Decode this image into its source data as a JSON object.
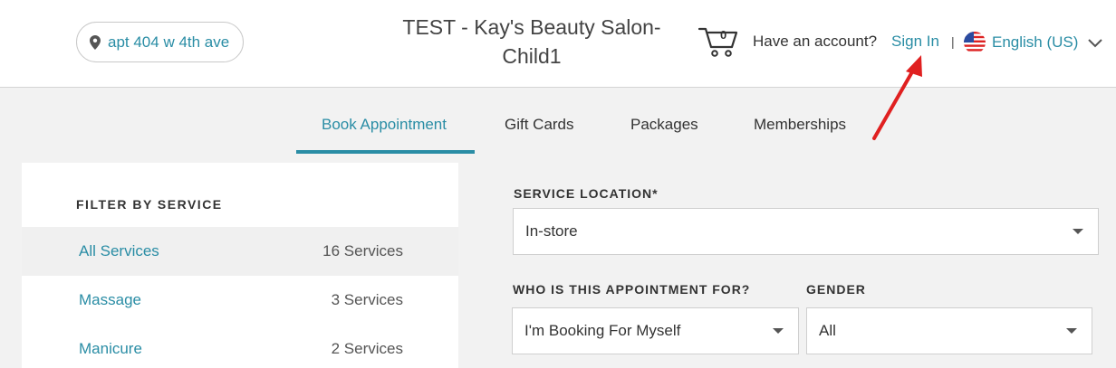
{
  "header": {
    "location": "apt 404 w 4th ave",
    "salon_name_line1": "TEST - Kay's Beauty Salon-",
    "salon_name_line2": "Child1",
    "cart_count": "0",
    "account_prompt": "Have an account?",
    "sign_in": "Sign In",
    "separator": "|",
    "language": "English (US)"
  },
  "tabs": [
    {
      "label": "Book Appointment",
      "active": true
    },
    {
      "label": "Gift Cards",
      "active": false
    },
    {
      "label": "Packages",
      "active": false
    },
    {
      "label": "Memberships",
      "active": false
    }
  ],
  "sidebar": {
    "title": "FILTER BY SERVICE",
    "services": [
      {
        "name": "All Services",
        "count": "16 Services",
        "selected": true
      },
      {
        "name": "Massage",
        "count": "3 Services",
        "selected": false
      },
      {
        "name": "Manicure",
        "count": "2 Services",
        "selected": false
      }
    ]
  },
  "form": {
    "location_label": "SERVICE LOCATION*",
    "location_value": "In-store",
    "who_label": "WHO IS THIS APPOINTMENT FOR?",
    "who_value": "I'm Booking For Myself",
    "gender_label": "GENDER",
    "gender_value": "All"
  },
  "colors": {
    "accent": "#2a8da5",
    "annotation_arrow": "#e02020"
  }
}
